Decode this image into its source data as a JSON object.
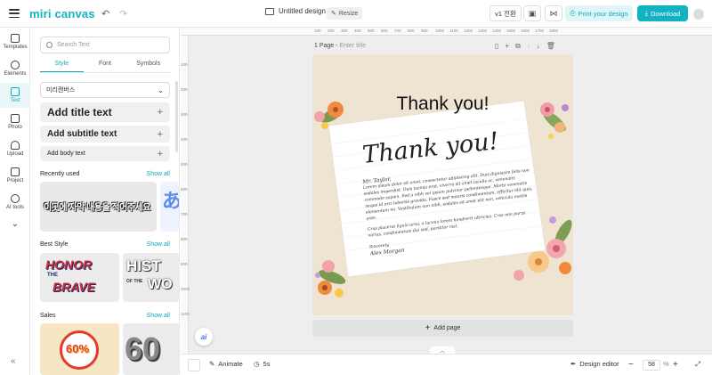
{
  "app": {
    "logo": "miri canvas"
  },
  "topbar": {
    "undo": "↶",
    "redo": "↷",
    "design_title": "Untitled design",
    "resize_label": "Resize",
    "version_label": "v1 전환",
    "print_label": "Print your design",
    "download_label": "Download"
  },
  "rail": {
    "items": [
      {
        "label": "Templates"
      },
      {
        "label": "Elements"
      },
      {
        "label": "Text"
      },
      {
        "label": "Photo"
      },
      {
        "label": "Upload"
      },
      {
        "label": "Project"
      },
      {
        "label": "AI tools"
      }
    ],
    "more": "⌄",
    "collapse": "«"
  },
  "panel": {
    "search_placeholder": "Search Text",
    "tabs": [
      "Style",
      "Font",
      "Symbols"
    ],
    "font_select": "미리캔버스",
    "add_title": "Add title text",
    "add_subtitle": "Add subtitle text",
    "add_body": "Add body text",
    "recently_used": "Recently used",
    "best_style": "Best Style",
    "sales": "Sales",
    "show_all": "Show all",
    "recent_thumb_text": "이곳에 자막 내용을 적어주세요",
    "best_thumb1_line1": "HONOR",
    "best_thumb1_line2": "BRAVE",
    "best_thumb1_small": "THE",
    "best_thumb2_line1": "HIST",
    "best_thumb2_line2": "WO",
    "best_thumb2_small": "OF THE",
    "sales_thumb1": "60%",
    "sales_thumb2": "60"
  },
  "canvas": {
    "page_label": "1 Page",
    "page_title_placeholder": "Enter title",
    "ruler_top": [
      "100",
      "200",
      "300",
      "400",
      "500",
      "600",
      "700",
      "800",
      "900",
      "1000",
      "1100",
      "1200",
      "1300",
      "1400",
      "1500",
      "1600",
      "1700",
      "1800"
    ],
    "ruler_left": [
      "100",
      "200",
      "300",
      "400",
      "500",
      "600",
      "700",
      "800",
      "900",
      "1000",
      "1100"
    ],
    "card": {
      "heading": "Thank you!",
      "script_title": "Thank you!",
      "greeting": "Mr. Taylor,",
      "body1": "Lorem ipsum dolor sit amet, consectetur adipiscing elit. Duis dignissim felis non sodales imperdiet. Duis lacinia erat, viverra sit amet iaculis ac, venenatis commodo sapien. Sed a nibh vel ipsum pulvinar pellentesque. Morbi venenatis neque id orci lobortis gravida. Fusce sed mauris condimentum, efficitur elit quis, elementum mi. Vestibulum non nibh, sodales sit amet elit non, vehicula mattis ante.",
      "body2": "Cras placerat ligula urna, a lacinia lorem hendrerit ultricies. Cras non purus varius, condimentum dui sed, porttitor nisl.",
      "closing": "Sincerely,",
      "signature": "Alex Morgan"
    },
    "add_page": "Add page",
    "ai_label": "ai"
  },
  "bottombar": {
    "animate": "Animate",
    "duration": "5s",
    "design_editor": "Design editor",
    "zoom": "58",
    "zoom_unit": "%"
  },
  "colors": {
    "accent": "#12b2c2",
    "page_bg": "#efe3d2"
  }
}
